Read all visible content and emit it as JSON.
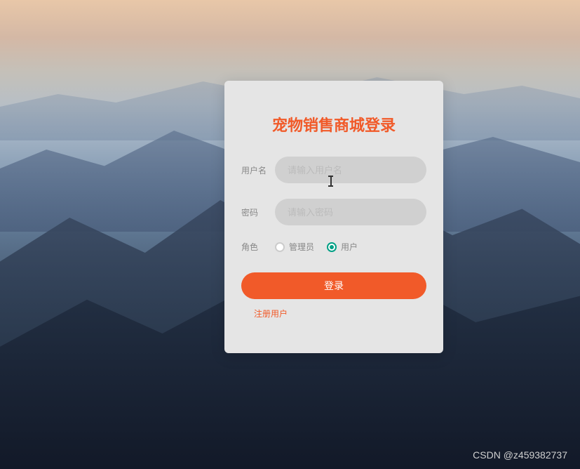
{
  "login": {
    "title": "宠物销售商城登录",
    "username_label": "用户名",
    "username_placeholder": "请输入用户名",
    "password_label": "密码",
    "password_placeholder": "请输入密码",
    "role_label": "角色",
    "role_admin": "管理员",
    "role_user": "用户",
    "role_selected": "user",
    "submit_label": "登录",
    "register_label": "注册用户"
  },
  "watermark": "CSDN @z459382737"
}
